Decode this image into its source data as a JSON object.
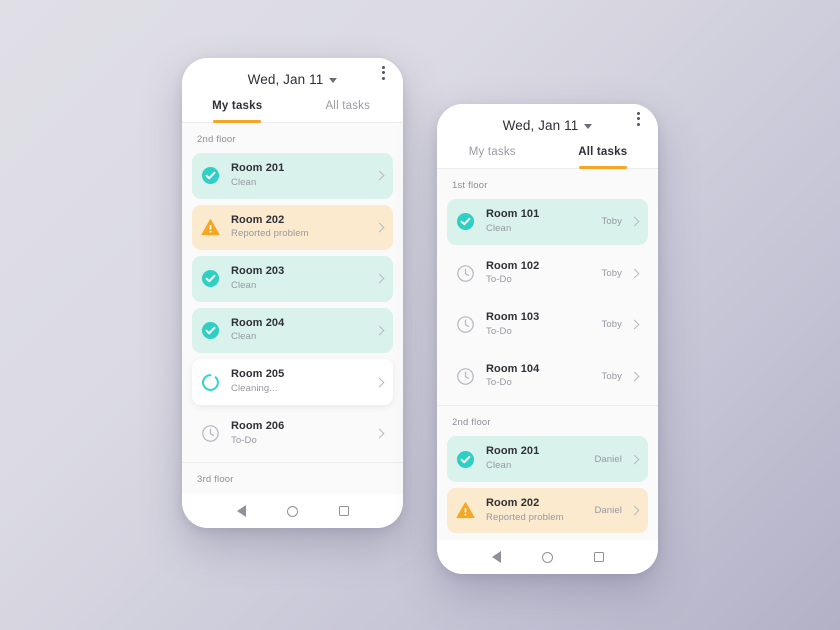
{
  "background": {
    "color_light": "#e0dfe6",
    "color_dark": "#b2b1c6"
  },
  "accent": {
    "orange": "#f5a623",
    "teal": "#2ecfc4",
    "clean_bg": "#d9f2ec",
    "problem_bg": "#fbeacd"
  },
  "phones": [
    {
      "id": "phone-a",
      "header": {
        "date": "Wed, Jan 11",
        "menu_icon": "kebab-menu-icon",
        "caret_icon": "chevron-down-icon"
      },
      "tabs": [
        {
          "label": "My tasks",
          "active": true
        },
        {
          "label": "All tasks",
          "active": false
        }
      ],
      "sections": [
        {
          "floor": "2nd floor",
          "tasks": [
            {
              "room": "Room 201",
              "status": "Clean",
              "state": "clean",
              "icon": "check-circle-icon",
              "assignee": ""
            },
            {
              "room": "Room 202",
              "status": "Reported problem",
              "state": "problem",
              "icon": "warning-triangle-icon",
              "assignee": ""
            },
            {
              "room": "Room 203",
              "status": "Clean",
              "state": "clean",
              "icon": "check-circle-icon",
              "assignee": ""
            },
            {
              "room": "Room 204",
              "status": "Clean",
              "state": "clean",
              "icon": "check-circle-icon",
              "assignee": ""
            },
            {
              "room": "Room 205",
              "status": "Cleaning...",
              "state": "progress",
              "icon": "spinner-icon",
              "assignee": ""
            },
            {
              "room": "Room 206",
              "status": "To-Do",
              "state": "todo",
              "icon": "clock-icon",
              "assignee": ""
            }
          ]
        },
        {
          "floor": "3rd floor",
          "tasks": []
        }
      ],
      "navbar": {
        "back": "back-triangle-icon",
        "home": "home-circle-icon",
        "recent": "recent-square-icon"
      }
    },
    {
      "id": "phone-b",
      "header": {
        "date": "Wed, Jan 11",
        "menu_icon": "kebab-menu-icon",
        "caret_icon": "chevron-down-icon"
      },
      "tabs": [
        {
          "label": "My tasks",
          "active": false
        },
        {
          "label": "All tasks",
          "active": true
        }
      ],
      "sections": [
        {
          "floor": "1st floor",
          "tasks": [
            {
              "room": "Room 101",
              "status": "Clean",
              "state": "clean",
              "icon": "check-circle-icon",
              "assignee": "Toby"
            },
            {
              "room": "Room 102",
              "status": "To-Do",
              "state": "todo",
              "icon": "clock-icon",
              "assignee": "Toby"
            },
            {
              "room": "Room 103",
              "status": "To-Do",
              "state": "todo",
              "icon": "clock-icon",
              "assignee": "Toby"
            },
            {
              "room": "Room 104",
              "status": "To-Do",
              "state": "todo",
              "icon": "clock-icon",
              "assignee": "Toby"
            }
          ]
        },
        {
          "floor": "2nd floor",
          "tasks": [
            {
              "room": "Room 201",
              "status": "Clean",
              "state": "clean",
              "icon": "check-circle-icon",
              "assignee": "Daniel"
            },
            {
              "room": "Room 202",
              "status": "Reported problem",
              "state": "problem",
              "icon": "warning-triangle-icon",
              "assignee": "Daniel"
            }
          ]
        }
      ],
      "navbar": {
        "back": "back-triangle-icon",
        "home": "home-circle-icon",
        "recent": "recent-square-icon"
      }
    }
  ]
}
